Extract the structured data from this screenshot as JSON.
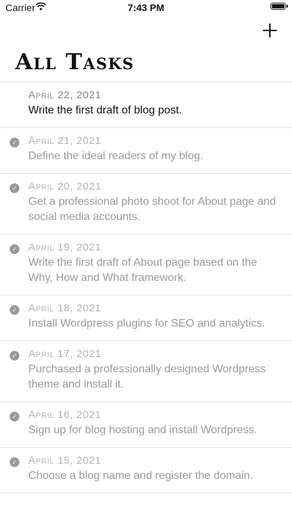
{
  "status_bar": {
    "carrier": "Carrier",
    "time": "7:43 PM"
  },
  "header": {
    "title": "All Tasks",
    "add_icon": "plus-icon"
  },
  "tasks": [
    {
      "date": "April 22, 2021",
      "text": "Write the first draft of blog post.",
      "completed": false
    },
    {
      "date": "April 21, 2021",
      "text": "Define the ideal readers of my blog.",
      "completed": true
    },
    {
      "date": "April 20, 2021",
      "text": "Get a professional photo shoot for About page and social media accounts.",
      "completed": true
    },
    {
      "date": "April 19, 2021",
      "text": "Write the first draft of About page based on the Why, How and What framework.",
      "completed": true
    },
    {
      "date": "April 18, 2021",
      "text": "Install Wordpress plugins for SEO and analytics.",
      "completed": true
    },
    {
      "date": "April 17, 2021",
      "text": "Purchased a professionally designed Wordpress theme and install it.",
      "completed": true
    },
    {
      "date": "April 16, 2021",
      "text": "Sign up for blog hosting and install Wordpress.",
      "completed": true
    },
    {
      "date": "April 15, 2021",
      "text": "Choose a blog name and register the domain.",
      "completed": true
    }
  ]
}
